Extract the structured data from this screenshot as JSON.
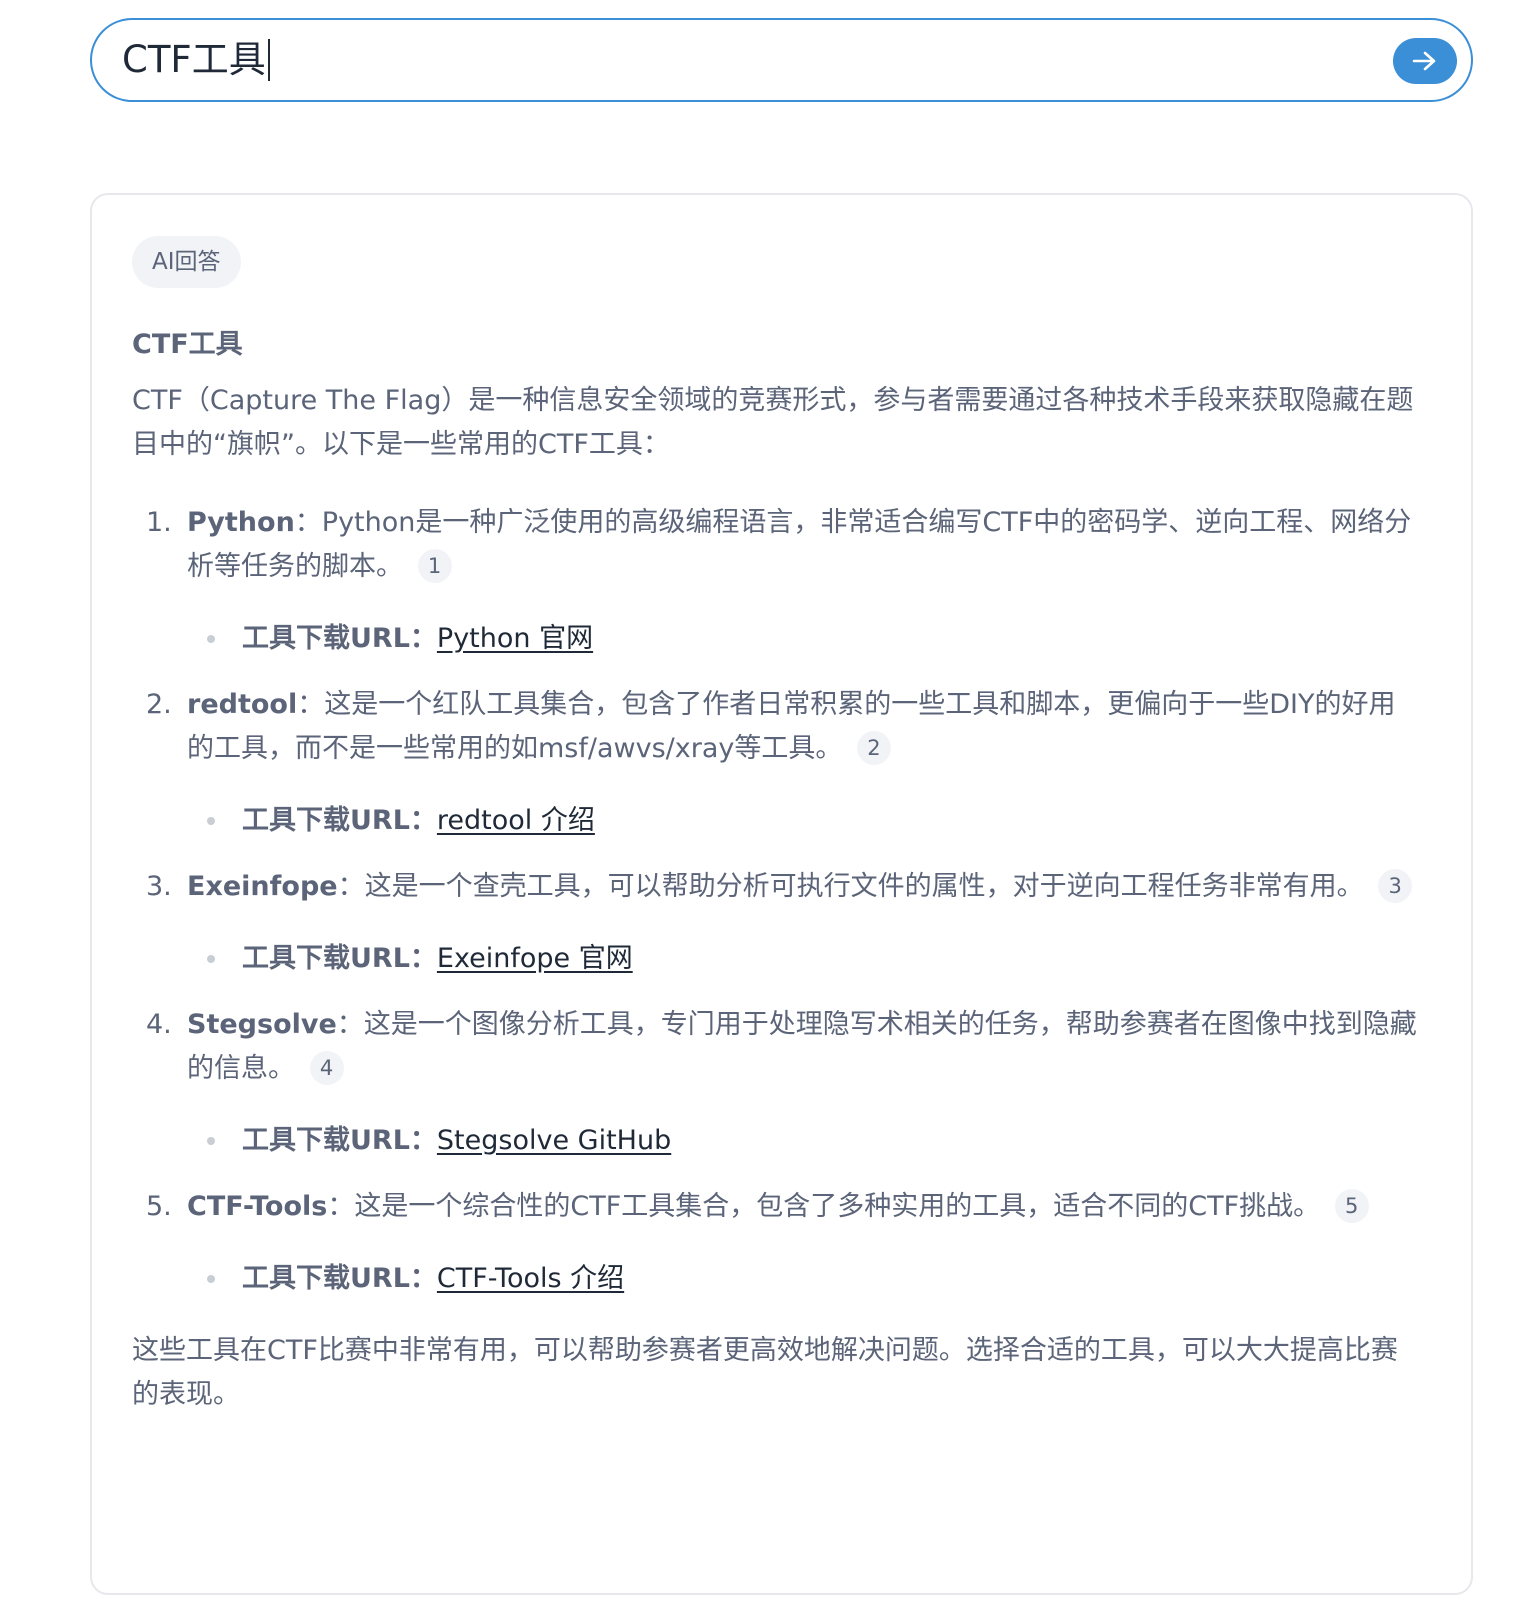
{
  "search": {
    "query": "CTF工具"
  },
  "answer": {
    "badge": "AI回答",
    "heading": "CTF工具",
    "intro": "CTF（Capture The Flag）是一种信息安全领域的竞赛形式，参与者需要通过各种技术手段来获取隐藏在题目中的“旗帜”。以下是一些常用的CTF工具：",
    "download_label": "工具下载URL：",
    "items": [
      {
        "number": "1.",
        "name": "Python",
        "sep": "：",
        "desc": "Python是一种广泛使用的高级编程语言，非常适合编写CTF中的密码学、逆向工程、网络分析等任务的脚本。",
        "cite": "1",
        "link_text": "Python 官网"
      },
      {
        "number": "2.",
        "name": "redtool",
        "sep": "：",
        "desc": "这是一个红队工具集合，包含了作者日常积累的一些工具和脚本，更偏向于一些DIY的好用的工具，而不是一些常用的如msf/awvs/xray等工具。",
        "cite": "2",
        "link_text": "redtool 介绍"
      },
      {
        "number": "3.",
        "name": "Exeinfope",
        "sep": "：",
        "desc": "这是一个查壳工具，可以帮助分析可执行文件的属性，对于逆向工程任务非常有用。",
        "cite": "3",
        "link_text": "Exeinfope 官网"
      },
      {
        "number": "4.",
        "name": "Stegsolve",
        "sep": "：",
        "desc": "这是一个图像分析工具，专门用于处理隐写术相关的任务，帮助参赛者在图像中找到隐藏的信息。",
        "cite": "4",
        "link_text": "Stegsolve GitHub"
      },
      {
        "number": "5.",
        "name": "CTF-Tools",
        "sep": "：",
        "desc": "这是一个综合性的CTF工具集合，包含了多种实用的工具，适合不同的CTF挑战。",
        "cite": "5",
        "link_text": "CTF-Tools 介绍"
      }
    ],
    "closing": "这些工具在CTF比赛中非常有用，可以帮助参赛者更高效地解决问题。选择合适的工具，可以大大提高比赛的表现。"
  },
  "colors": {
    "accent": "#3b8fd6",
    "text": "#5b6478",
    "link": "#1f2937",
    "badge_bg": "#f1f3f6"
  }
}
